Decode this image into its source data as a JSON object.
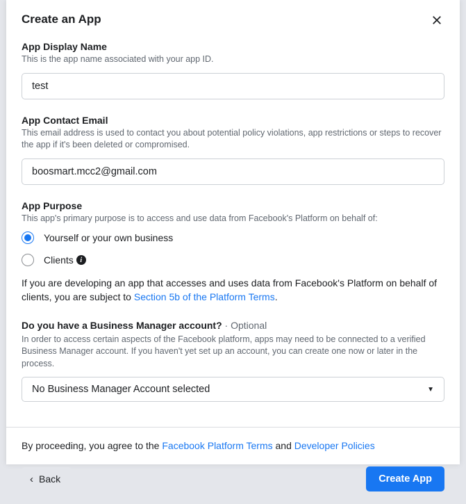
{
  "modal": {
    "title": "Create an App"
  },
  "displayName": {
    "label": "App Display Name",
    "desc": "This is the app name associated with your app ID.",
    "value": "test"
  },
  "contactEmail": {
    "label": "App Contact Email",
    "desc": "This email address is used to contact you about potential policy violations, app restrictions or steps to recover the app if it's been deleted or compromised.",
    "value": "boosmart.mcc2@gmail.com"
  },
  "purpose": {
    "label": "App Purpose",
    "desc": "This app's primary purpose is to access and use data from Facebook's Platform on behalf of:",
    "option1": "Yourself or your own business",
    "option2": "Clients",
    "notePrefix": "If you are developing an app that accesses and uses data from Facebook's Platform on behalf of clients, you are subject to ",
    "noteLink": "Section 5b of the Platform Terms",
    "noteSuffix": "."
  },
  "businessManager": {
    "label": "Do you have a Business Manager account?",
    "optional": " · Optional",
    "desc": "In order to access certain aspects of the Facebook platform, apps may need to be connected to a verified Business Manager account. If you haven't yet set up an account, you can create one now or later in the process.",
    "selected": "No Business Manager Account selected"
  },
  "agree": {
    "prefix": "By proceeding, you agree to the ",
    "link1": "Facebook Platform Terms",
    "mid": " and ",
    "link2": "Developer Policies"
  },
  "buttons": {
    "back": "Back",
    "create": "Create App"
  }
}
